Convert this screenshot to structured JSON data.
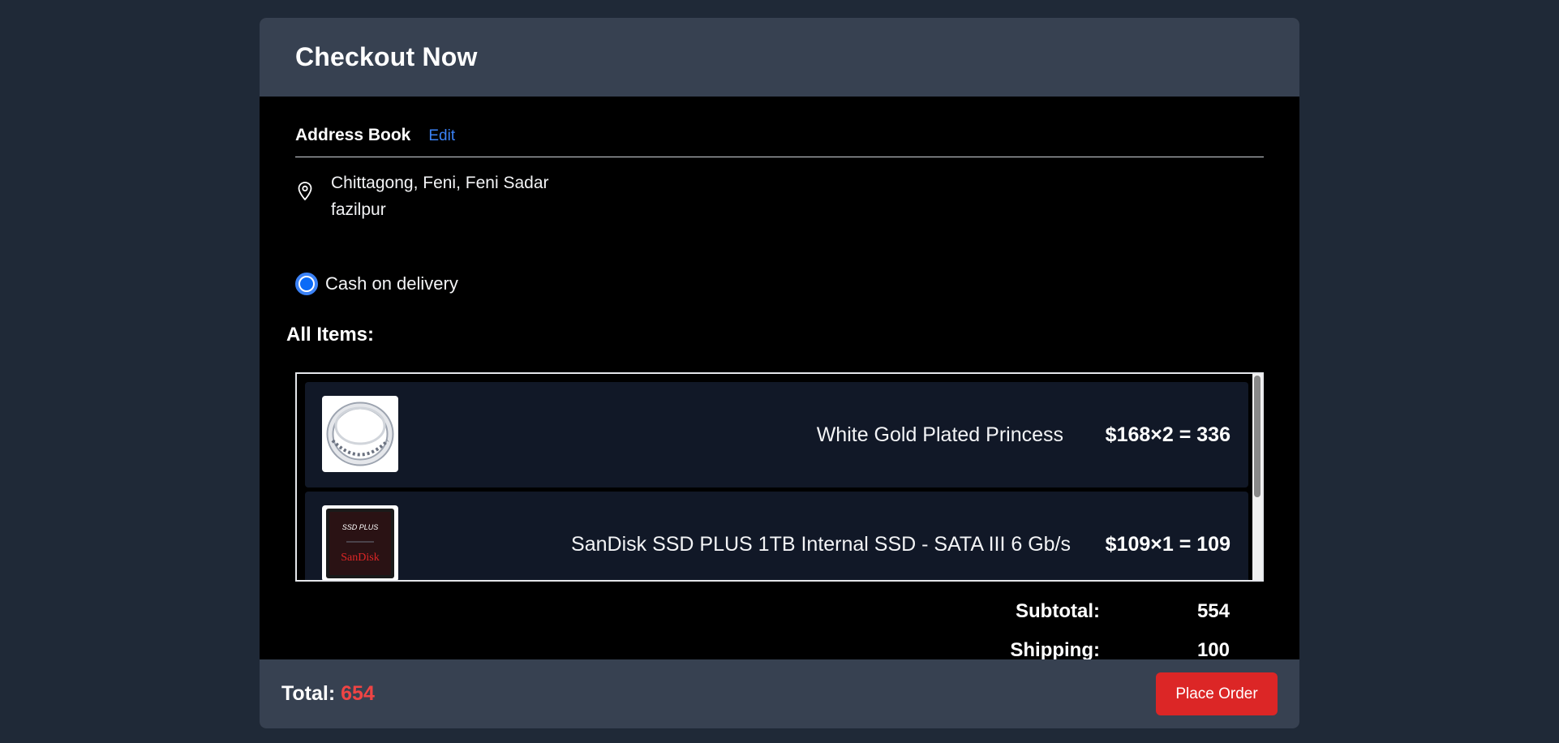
{
  "modal": {
    "title": "Checkout Now"
  },
  "address": {
    "title": "Address Book",
    "edit_label": "Edit",
    "line1": "Chittagong, Feni, Feni Sadar",
    "line2": "fazilpur",
    "icon": "map-pin-icon"
  },
  "payment": {
    "label": "Cash on delivery",
    "selected": true,
    "accent_color": "#0b6bf7"
  },
  "items": {
    "heading": "All Items:",
    "list": [
      {
        "name": "White Gold Plated Princess",
        "price_text": "$168×2 = 336",
        "image": "ring-image"
      },
      {
        "name": "SanDisk SSD PLUS 1TB Internal SSD - SATA III 6 Gb/s",
        "price_text": "$109×1 = 109",
        "image": "ssd-image",
        "image_brand": "SanDisk",
        "image_model": "SSD PLUS"
      }
    ]
  },
  "summary": {
    "subtotal_label": "Subtotal:",
    "subtotal_value": "554",
    "shipping_label": "Shipping:",
    "shipping_value": "100"
  },
  "footer": {
    "total_label": "Total:",
    "total_value": "654",
    "total_color": "#ef4444",
    "place_order_label": "Place Order",
    "button_color": "#dc2626"
  }
}
